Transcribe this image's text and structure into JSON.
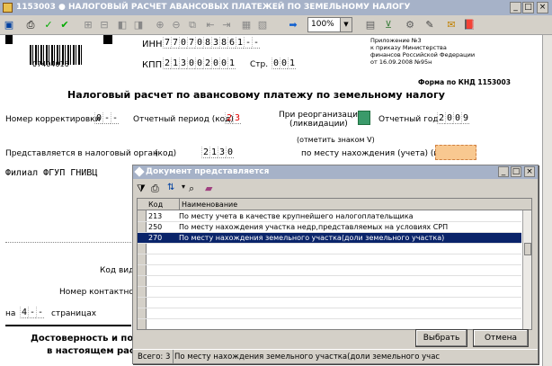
{
  "window": {
    "title": "1153003 ● НАЛОГОВЫЙ РАСЧЕТ АВАНСОВЫХ ПЛАТЕЖЕЙ ПО ЗЕМЕЛЬНОМУ НАЛОГУ"
  },
  "toolbar": {
    "zoom": "100%"
  },
  "doc": {
    "barcode_number": "07404016",
    "inn_label": "ИНН",
    "inn_cells": [
      "7",
      "7",
      "0",
      "7",
      "0",
      "8",
      "3",
      "8",
      "6",
      "1",
      "-",
      "-"
    ],
    "kpp_label": "КПП",
    "kpp_cells": [
      "2",
      "1",
      "3",
      "0",
      "0",
      "2",
      "0",
      "0",
      "1"
    ],
    "page_label": "Стр.",
    "page_cells": [
      "0",
      "0",
      "1"
    ],
    "appendix_lines": [
      "Приложение №3",
      "к приказу Министерства",
      "финансов Российской Федерации",
      "от 16.09.2008 №95н"
    ],
    "form_code": "Форма по КНД 1153003",
    "main_title": "Налоговый расчет по авансовому платежу по земельному налогу",
    "correction_label": "Номер корректировки",
    "correction_cells": [
      "0",
      "-",
      "-"
    ],
    "period_label": "Отчетный период (код)",
    "period_cells": [
      "2",
      "3"
    ],
    "reorg_label_1": "При реорганизации",
    "reorg_label_2": "(ликвидации)",
    "reorg_note": "(отметить знаком V)",
    "year_label": "Отчетный год",
    "year_cells": [
      "2",
      "0",
      "0",
      "9"
    ],
    "authority_label": "Представляется в налоговый орган",
    "authority_code_label": "(код)",
    "authority_cells": [
      "2",
      "1",
      "3",
      "0"
    ],
    "location_label": "по месту нахождения (учета) (код)",
    "org_name_partial": "Филиал ФГУП ГНИВЦ",
    "okved_partial": "Код вида",
    "phone_partial": "Номер контактного",
    "pages_prefix": "на",
    "pages_cells": [
      "4",
      "-",
      "-"
    ],
    "pages_suffix": "страницах",
    "trust_line_1": "Достоверность и полнот",
    "trust_line_2": "в настоящем расчет"
  },
  "dialog": {
    "title": "Документ представляется",
    "columns": [
      "Код",
      "Наименование"
    ],
    "rows": [
      {
        "code": "213",
        "name": "По месту учета в качестве крупнейшего налогоплательщика",
        "selected": false
      },
      {
        "code": "250",
        "name": "По месту нахождения участка недр,представляемых на условиях СРП",
        "selected": false
      },
      {
        "code": "270",
        "name": "По месту нахождения земельного участка(доли земельного участка)",
        "selected": true
      }
    ],
    "select_button": "Выбрать",
    "cancel_button": "Отмена",
    "status_count": "Всего: 3",
    "status_text": "По месту нахождения земельного участка(доли земельного учас"
  }
}
